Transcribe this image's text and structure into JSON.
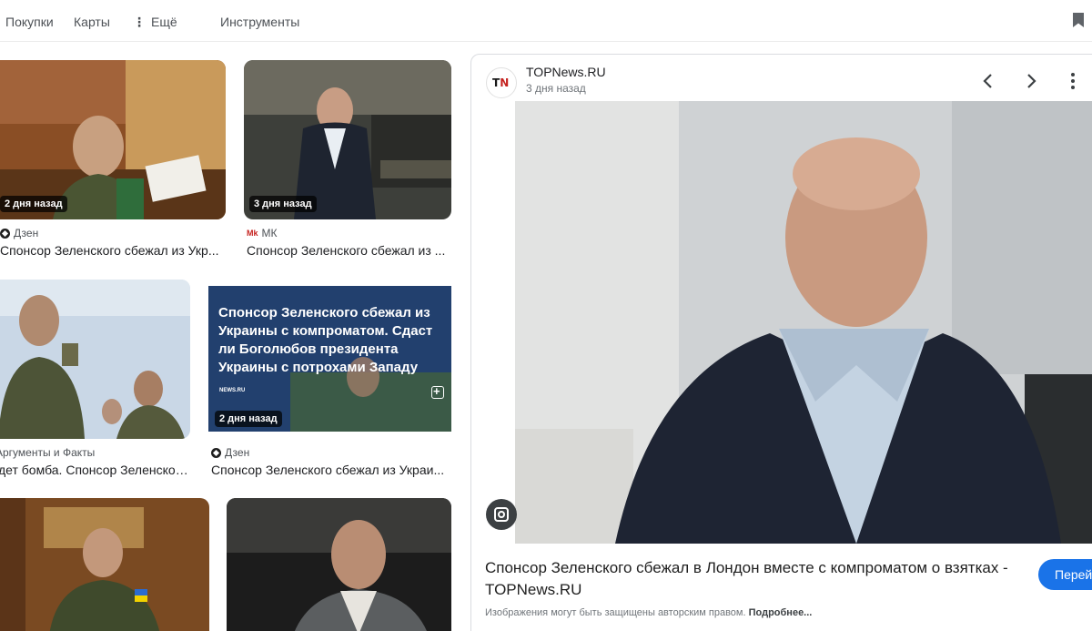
{
  "nav": {
    "items": [
      "Покупки",
      "Карты",
      "Ещё",
      "Инструменты"
    ]
  },
  "results": [
    {
      "age": "2 дня назад",
      "source": "Дзен",
      "title": "Спонсор Зеленского сбежал из Укр..."
    },
    {
      "age": "3 дня назад",
      "source": "МК",
      "title": "Спонсор Зеленского сбежал из ..."
    },
    {
      "age": "",
      "source": "Аргументы и Факты",
      "title": "дет бомба. Спонсор Зеленского..."
    },
    {
      "age": "2 дня назад",
      "source": "Дзен",
      "title": "Спонсор Зеленского сбежал из Украи...",
      "image_text": "Спонсор Зеленского сбежал из Украины с компроматом. Сдаст ли Боголюбов президента Украины с потрохами Западу",
      "image_badge": "NEWS.RU"
    },
    {
      "age": "",
      "source": "",
      "title": ""
    },
    {
      "age": "",
      "source": "",
      "title": ""
    }
  ],
  "panel": {
    "logo_t": "T",
    "logo_n": "N",
    "source": "TOPNews.RU",
    "date": "3 дня назад",
    "title": "Спонсор Зеленского сбежал в Лондон вместе с компроматом о взятках - TOPNews.RU",
    "copyright_note": "Изображения могут быть защищены авторским правом.",
    "more_link": "Подробнее...",
    "visit_label": "Перей"
  },
  "icons": {
    "bookmark": "bookmark-icon",
    "prev": "chevron-left-icon",
    "next": "chevron-right-icon",
    "more": "more-vert-icon",
    "lens": "lens-icon"
  }
}
